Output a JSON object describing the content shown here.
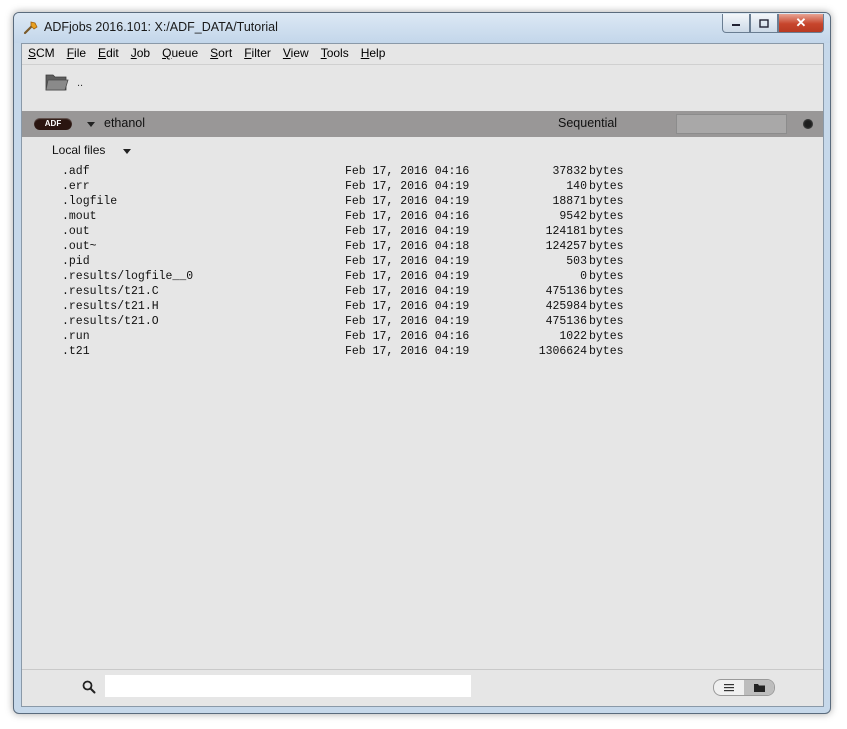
{
  "window": {
    "title": "ADFjobs 2016.101: X:/ADF_DATA/Tutorial"
  },
  "menu": [
    {
      "label": "SCM",
      "key": "S",
      "rest": "CM"
    },
    {
      "label": "File",
      "key": "F",
      "rest": "ile"
    },
    {
      "label": "Edit",
      "key": "E",
      "rest": "dit"
    },
    {
      "label": "Job",
      "key": "J",
      "rest": "ob"
    },
    {
      "label": "Queue",
      "key": "Q",
      "rest": "ueue"
    },
    {
      "label": "Sort",
      "key": "S",
      "rest": "ort"
    },
    {
      "label": "Filter",
      "key": "F",
      "rest": "ilter"
    },
    {
      "label": "View",
      "key": "V",
      "rest": "iew"
    },
    {
      "label": "Tools",
      "key": "T",
      "rest": "ools"
    },
    {
      "label": "Help",
      "key": "H",
      "rest": "elp"
    }
  ],
  "toolbar": {
    "parent_dir": ".."
  },
  "job": {
    "badge": "ADF",
    "name": "ethanol",
    "queue": "Sequential"
  },
  "files_header": "Local files",
  "files": [
    {
      "name": ".adf",
      "date": "Feb 17, 2016 04:16",
      "size": "37832",
      "unit": "bytes"
    },
    {
      "name": ".err",
      "date": "Feb 17, 2016 04:19",
      "size": "140",
      "unit": "bytes"
    },
    {
      "name": ".logfile",
      "date": "Feb 17, 2016 04:19",
      "size": "18871",
      "unit": "bytes"
    },
    {
      "name": ".mout",
      "date": "Feb 17, 2016 04:16",
      "size": "9542",
      "unit": "bytes"
    },
    {
      "name": ".out",
      "date": "Feb 17, 2016 04:19",
      "size": "124181",
      "unit": "bytes"
    },
    {
      "name": ".out~",
      "date": "Feb 17, 2016 04:18",
      "size": "124257",
      "unit": "bytes"
    },
    {
      "name": ".pid",
      "date": "Feb 17, 2016 04:19",
      "size": "503",
      "unit": "bytes"
    },
    {
      "name": ".results/logfile__0",
      "date": "Feb 17, 2016 04:19",
      "size": "0",
      "unit": "bytes"
    },
    {
      "name": ".results/t21.C",
      "date": "Feb 17, 2016 04:19",
      "size": "475136",
      "unit": "bytes"
    },
    {
      "name": ".results/t21.H",
      "date": "Feb 17, 2016 04:19",
      "size": "425984",
      "unit": "bytes"
    },
    {
      "name": ".results/t21.O",
      "date": "Feb 17, 2016 04:19",
      "size": "475136",
      "unit": "bytes"
    },
    {
      "name": ".run",
      "date": "Feb 17, 2016 04:16",
      "size": "1022",
      "unit": "bytes"
    },
    {
      "name": ".t21",
      "date": "Feb 17, 2016 04:19",
      "size": "1306624",
      "unit": "bytes"
    }
  ],
  "search": {
    "value": "",
    "placeholder": ""
  },
  "icons": {
    "app": "scm-tool-icon",
    "folder": "folder-icon",
    "search": "search-icon",
    "list_view": "list-view-icon",
    "folder_view": "folder-view-icon"
  }
}
